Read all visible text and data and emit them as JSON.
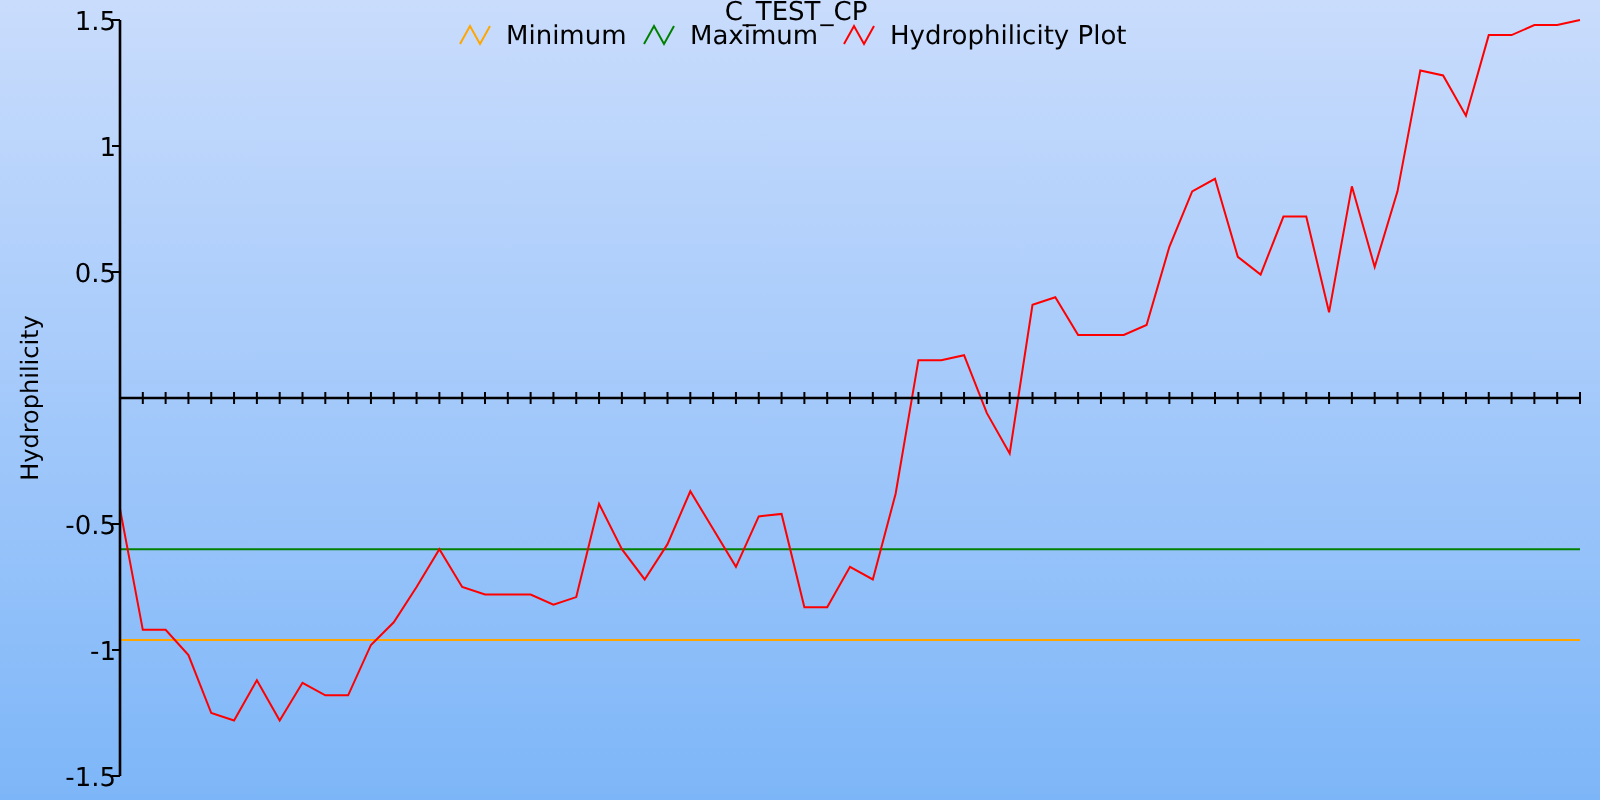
{
  "chart_data": {
    "type": "line",
    "title": "C_TEST_CP",
    "ylabel": "Hydrophilicity",
    "ylim": [
      -1.5,
      1.5
    ],
    "legend": "top",
    "yticks": [
      -1.5,
      -1,
      -0.5,
      0.5,
      1,
      1.5
    ],
    "series": [
      {
        "name": "Minimum",
        "color": "#ffa500",
        "values": [
          -0.96,
          -0.96,
          -0.96,
          -0.96,
          -0.96,
          -0.96,
          -0.96,
          -0.96,
          -0.96,
          -0.96,
          -0.96,
          -0.96,
          -0.96,
          -0.96,
          -0.96,
          -0.96,
          -0.96,
          -0.96,
          -0.96,
          -0.96,
          -0.96,
          -0.96,
          -0.96,
          -0.96,
          -0.96,
          -0.96,
          -0.96,
          -0.96,
          -0.96,
          -0.96,
          -0.96,
          -0.96,
          -0.96,
          -0.96,
          -0.96,
          -0.96,
          -0.96,
          -0.96,
          -0.96,
          -0.96,
          -0.96,
          -0.96,
          -0.96,
          -0.96,
          -0.96,
          -0.96,
          -0.96,
          -0.96,
          -0.96,
          -0.96,
          -0.96,
          -0.96,
          -0.96,
          -0.96,
          -0.96,
          -0.96,
          -0.96,
          -0.96,
          -0.96,
          -0.96,
          -0.96,
          -0.96,
          -0.96,
          -0.96,
          -0.96
        ]
      },
      {
        "name": "Maximum",
        "color": "#008000",
        "values": [
          -0.6,
          -0.6,
          -0.6,
          -0.6,
          -0.6,
          -0.6,
          -0.6,
          -0.6,
          -0.6,
          -0.6,
          -0.6,
          -0.6,
          -0.6,
          -0.6,
          -0.6,
          -0.6,
          -0.6,
          -0.6,
          -0.6,
          -0.6,
          -0.6,
          -0.6,
          -0.6,
          -0.6,
          -0.6,
          -0.6,
          -0.6,
          -0.6,
          -0.6,
          -0.6,
          -0.6,
          -0.6,
          -0.6,
          -0.6,
          -0.6,
          -0.6,
          -0.6,
          -0.6,
          -0.6,
          -0.6,
          -0.6,
          -0.6,
          -0.6,
          -0.6,
          -0.6,
          -0.6,
          -0.6,
          -0.6,
          -0.6,
          -0.6,
          -0.6,
          -0.6,
          -0.6,
          -0.6,
          -0.6,
          -0.6,
          -0.6,
          -0.6,
          -0.6,
          -0.6,
          -0.6,
          -0.6,
          -0.6,
          -0.6,
          -0.6
        ]
      },
      {
        "name": "Hydrophilicity Plot",
        "color": "#ff0000",
        "values": [
          -0.44,
          -0.92,
          -0.92,
          -1.02,
          -1.25,
          -1.28,
          -1.12,
          -1.28,
          -1.13,
          -1.18,
          -1.18,
          -0.98,
          -0.89,
          -0.75,
          -0.6,
          -0.75,
          -0.78,
          -0.78,
          -0.78,
          -0.82,
          -0.79,
          -0.42,
          -0.6,
          -0.72,
          -0.58,
          -0.37,
          -0.52,
          -0.67,
          -0.47,
          -0.46,
          -0.83,
          -0.83,
          -0.67,
          -0.72,
          -0.38,
          0.15,
          0.15,
          0.17,
          -0.06,
          -0.22,
          0.37,
          0.4,
          0.25,
          0.25,
          0.25,
          0.29,
          0.6,
          0.82,
          0.87,
          0.56,
          0.49,
          0.72,
          0.72,
          0.34,
          0.84,
          0.52,
          0.82,
          1.3,
          1.28,
          1.12,
          1.44,
          1.44,
          1.48,
          1.48,
          1.5
        ]
      }
    ]
  }
}
